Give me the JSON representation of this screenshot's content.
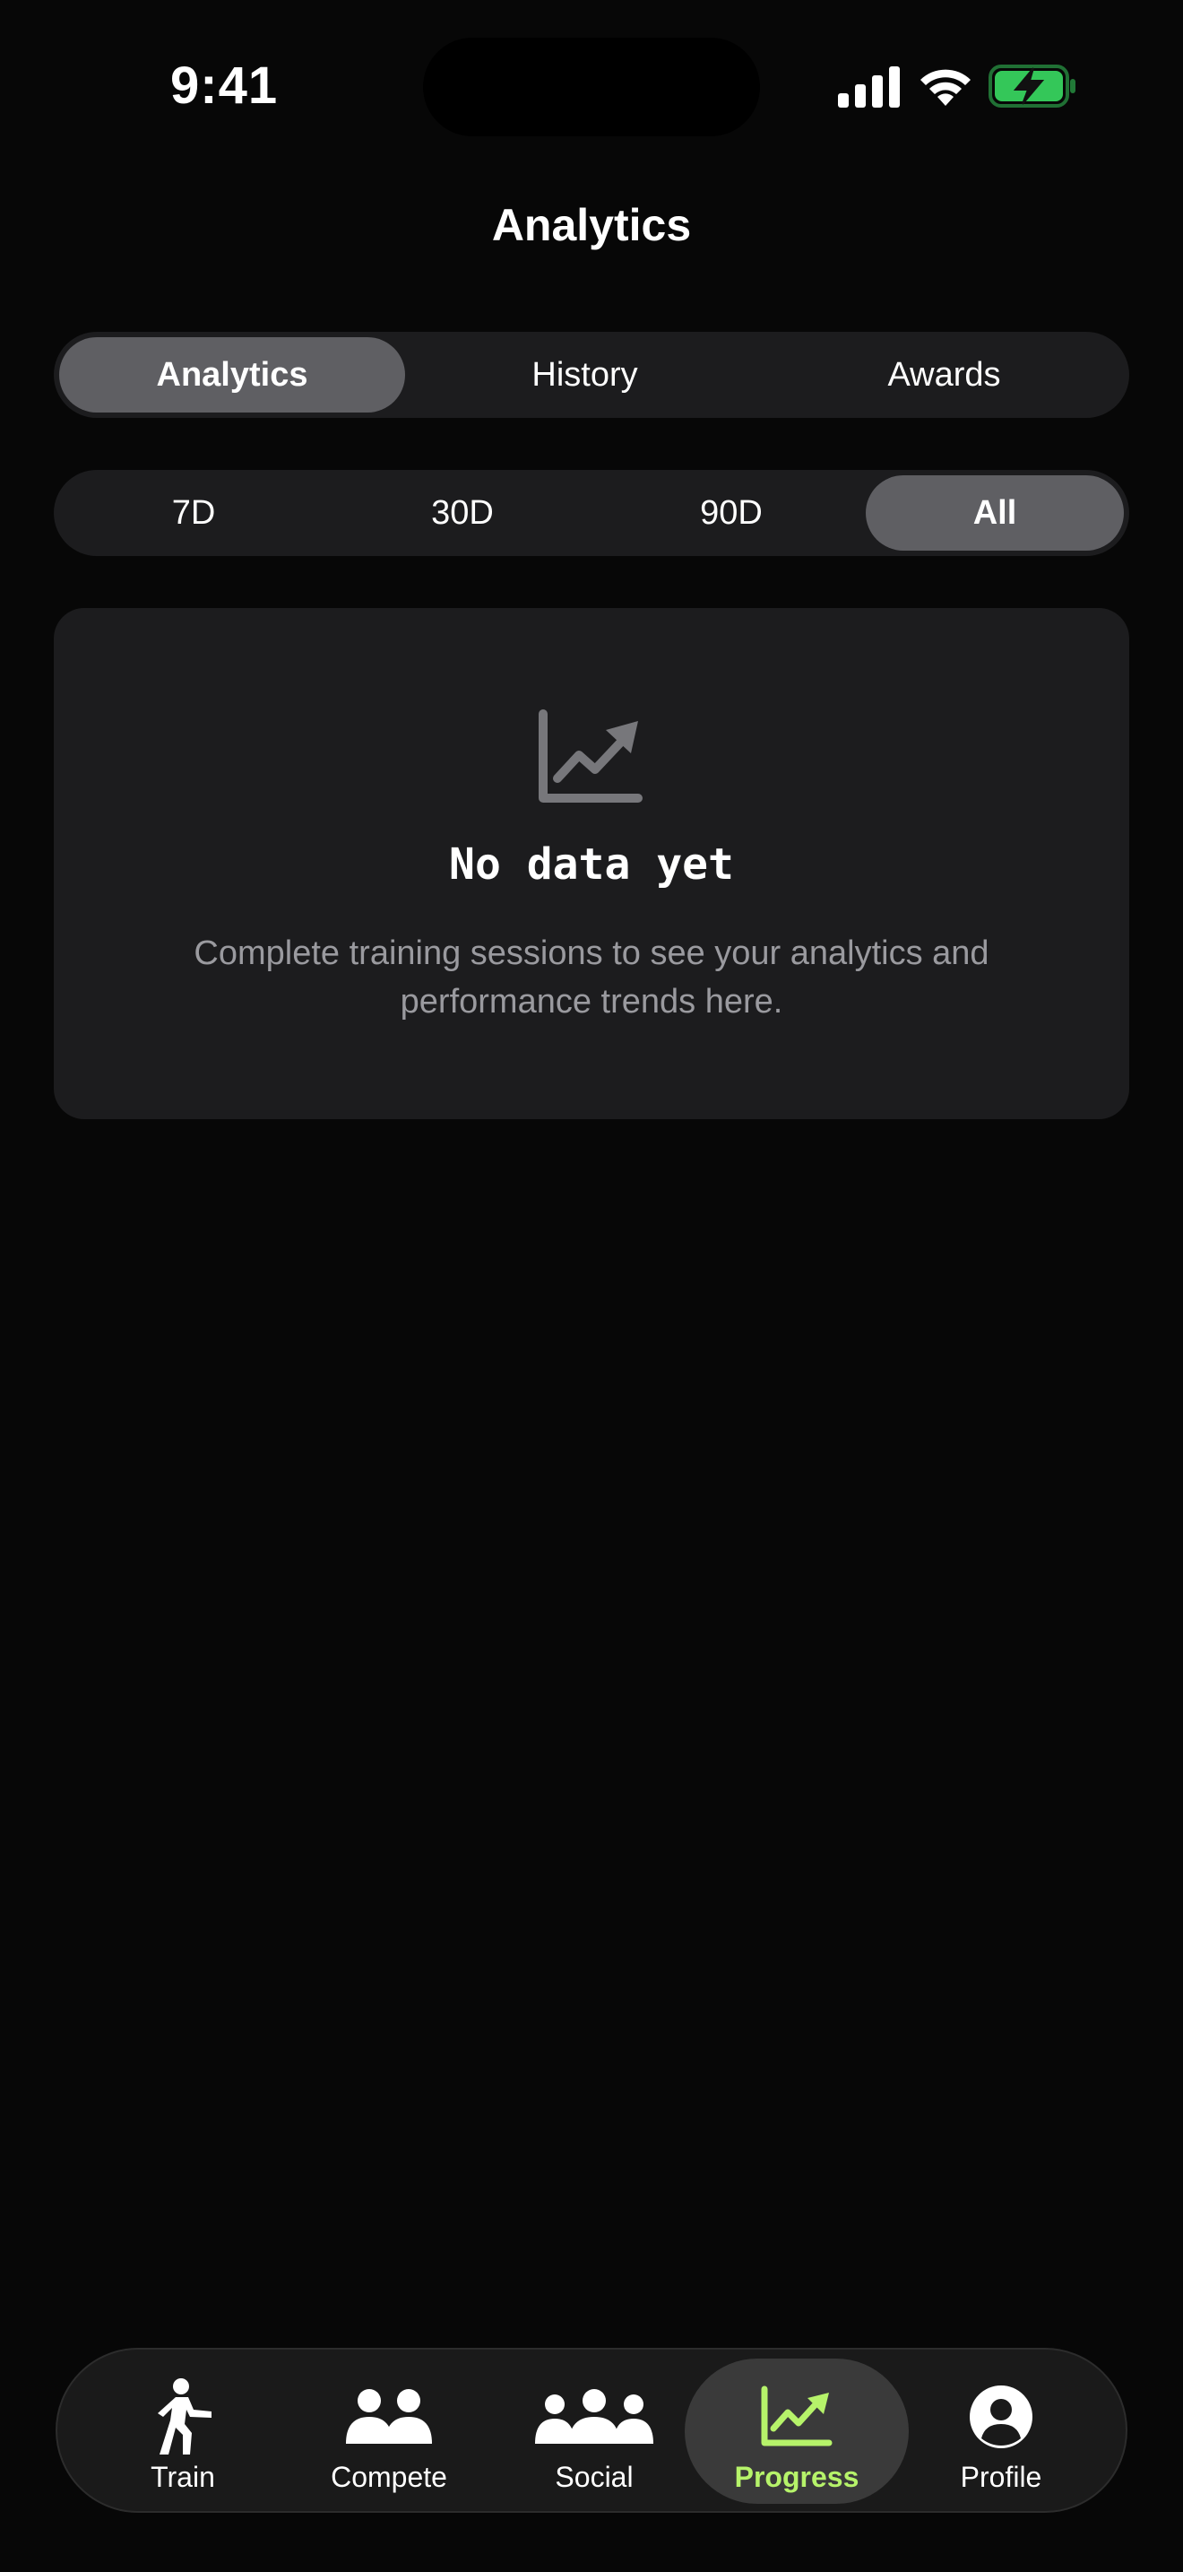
{
  "status_bar": {
    "time": "9:41",
    "icons": [
      "cellular-signal-icon",
      "wifi-icon",
      "battery-charging-icon"
    ],
    "battery_color": "#34c759"
  },
  "header": {
    "title": "Analytics"
  },
  "view_tabs": {
    "items": [
      {
        "label": "Analytics",
        "active": true
      },
      {
        "label": "History",
        "active": false
      },
      {
        "label": "Awards",
        "active": false
      }
    ]
  },
  "range_tabs": {
    "items": [
      {
        "label": "7D",
        "active": false
      },
      {
        "label": "30D",
        "active": false
      },
      {
        "label": "90D",
        "active": false
      },
      {
        "label": "All",
        "active": true
      }
    ]
  },
  "empty_state": {
    "icon": "chart-line-up-icon",
    "title": "No data yet",
    "description": "Complete training sessions to see your analytics and performance trends here."
  },
  "tab_bar": {
    "accent_color": "#b6f36a",
    "items": [
      {
        "label": "Train",
        "icon": "runner-icon",
        "active": false
      },
      {
        "label": "Compete",
        "icon": "two-people-icon",
        "active": false
      },
      {
        "label": "Social",
        "icon": "group-icon",
        "active": false
      },
      {
        "label": "Progress",
        "icon": "chart-line-up-icon",
        "active": true
      },
      {
        "label": "Profile",
        "icon": "profile-icon",
        "active": false
      }
    ]
  }
}
